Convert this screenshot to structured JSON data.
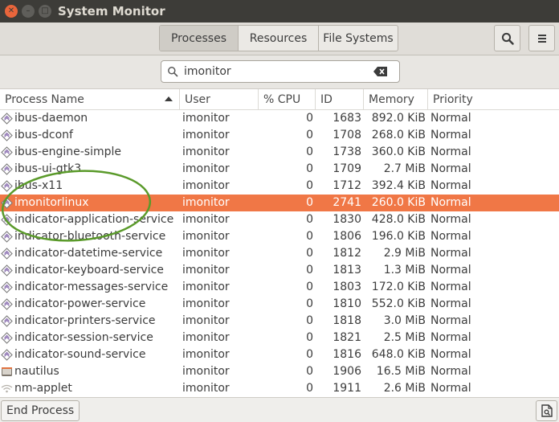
{
  "window": {
    "title": "System Monitor",
    "close_glyph": "✕",
    "min_glyph": "–",
    "max_glyph": "□"
  },
  "tabs": [
    {
      "label": "Processes",
      "active": true
    },
    {
      "label": "Resources",
      "active": false
    },
    {
      "label": "File Systems",
      "active": false
    }
  ],
  "header_icons": {
    "search": "search-icon",
    "menu": "hamburger-menu-icon"
  },
  "search": {
    "value": "imonitor",
    "placeholder": ""
  },
  "columns": {
    "name": "Process Name",
    "user": "User",
    "cpu": "% CPU",
    "id": "ID",
    "memory": "Memory",
    "priority": "Priority"
  },
  "processes": [
    {
      "name": "ibus-daemon",
      "user": "imonitor",
      "cpu": "0",
      "id": "1683",
      "memory": "892.0 KiB",
      "priority": "Normal",
      "icon": "diamond"
    },
    {
      "name": "ibus-dconf",
      "user": "imonitor",
      "cpu": "0",
      "id": "1708",
      "memory": "268.0 KiB",
      "priority": "Normal",
      "icon": "diamond"
    },
    {
      "name": "ibus-engine-simple",
      "user": "imonitor",
      "cpu": "0",
      "id": "1738",
      "memory": "360.0 KiB",
      "priority": "Normal",
      "icon": "diamond"
    },
    {
      "name": "ibus-ui-gtk3",
      "user": "imonitor",
      "cpu": "0",
      "id": "1709",
      "memory": "2.7 MiB",
      "priority": "Normal",
      "icon": "diamond"
    },
    {
      "name": "ibus-x11",
      "user": "imonitor",
      "cpu": "0",
      "id": "1712",
      "memory": "392.4 KiB",
      "priority": "Normal",
      "icon": "diamond"
    },
    {
      "name": "imonitorlinux",
      "user": "imonitor",
      "cpu": "0",
      "id": "2741",
      "memory": "260.0 KiB",
      "priority": "Normal",
      "icon": "diamond",
      "selected": true
    },
    {
      "name": "indicator-application-service",
      "user": "imonitor",
      "cpu": "0",
      "id": "1830",
      "memory": "428.0 KiB",
      "priority": "Normal",
      "icon": "diamond"
    },
    {
      "name": "indicator-bluetooth-service",
      "user": "imonitor",
      "cpu": "0",
      "id": "1806",
      "memory": "196.0 KiB",
      "priority": "Normal",
      "icon": "diamond"
    },
    {
      "name": "indicator-datetime-service",
      "user": "imonitor",
      "cpu": "0",
      "id": "1812",
      "memory": "2.9 MiB",
      "priority": "Normal",
      "icon": "diamond"
    },
    {
      "name": "indicator-keyboard-service",
      "user": "imonitor",
      "cpu": "0",
      "id": "1813",
      "memory": "1.3 MiB",
      "priority": "Normal",
      "icon": "diamond"
    },
    {
      "name": "indicator-messages-service",
      "user": "imonitor",
      "cpu": "0",
      "id": "1803",
      "memory": "172.0 KiB",
      "priority": "Normal",
      "icon": "diamond"
    },
    {
      "name": "indicator-power-service",
      "user": "imonitor",
      "cpu": "0",
      "id": "1810",
      "memory": "552.0 KiB",
      "priority": "Normal",
      "icon": "diamond"
    },
    {
      "name": "indicator-printers-service",
      "user": "imonitor",
      "cpu": "0",
      "id": "1818",
      "memory": "3.0 MiB",
      "priority": "Normal",
      "icon": "diamond"
    },
    {
      "name": "indicator-session-service",
      "user": "imonitor",
      "cpu": "0",
      "id": "1821",
      "memory": "2.5 MiB",
      "priority": "Normal",
      "icon": "diamond"
    },
    {
      "name": "indicator-sound-service",
      "user": "imonitor",
      "cpu": "0",
      "id": "1816",
      "memory": "648.0 KiB",
      "priority": "Normal",
      "icon": "diamond"
    },
    {
      "name": "nautilus",
      "user": "imonitor",
      "cpu": "0",
      "id": "1906",
      "memory": "16.5 MiB",
      "priority": "Normal",
      "icon": "file-manager"
    },
    {
      "name": "nm-applet",
      "user": "imonitor",
      "cpu": "0",
      "id": "1911",
      "memory": "2.6 MiB",
      "priority": "Normal",
      "icon": "wifi"
    }
  ],
  "footer": {
    "end_process_label": "End Process",
    "properties_icon": "properties-icon"
  },
  "colors": {
    "selection": "#f07746",
    "annotation": "#5a9a2a",
    "titlebar": "#3d3c38",
    "close": "#e9653b"
  }
}
